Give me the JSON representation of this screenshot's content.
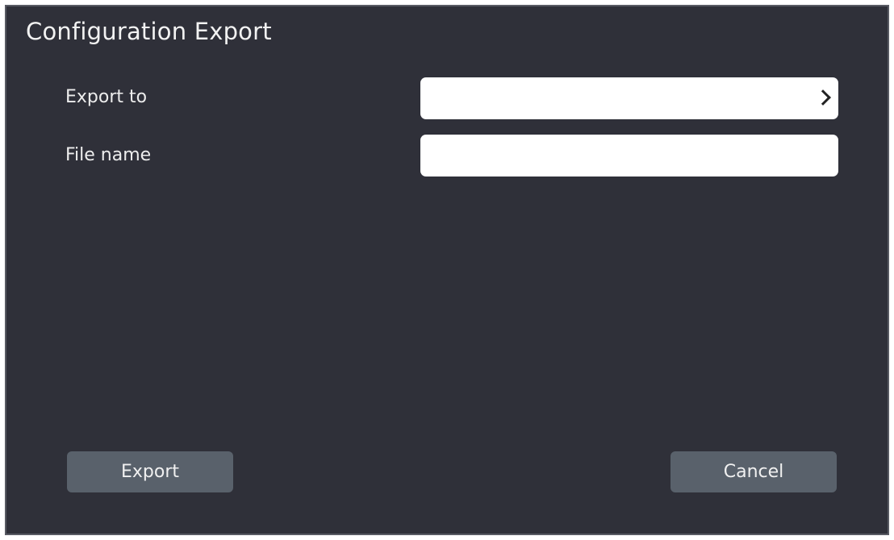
{
  "dialog": {
    "title": "Configuration Export",
    "export_to": {
      "label": "Export to",
      "value": ""
    },
    "file_name": {
      "label": "File name",
      "value": ""
    },
    "buttons": {
      "export_label": "Export",
      "cancel_label": "Cancel"
    }
  },
  "icons": {
    "browse": "chevron-right-icon"
  },
  "colors": {
    "background": "#2f3039",
    "border": "#585a63",
    "button": "#59616b",
    "field": "#ffffff",
    "text": "#ededed"
  }
}
